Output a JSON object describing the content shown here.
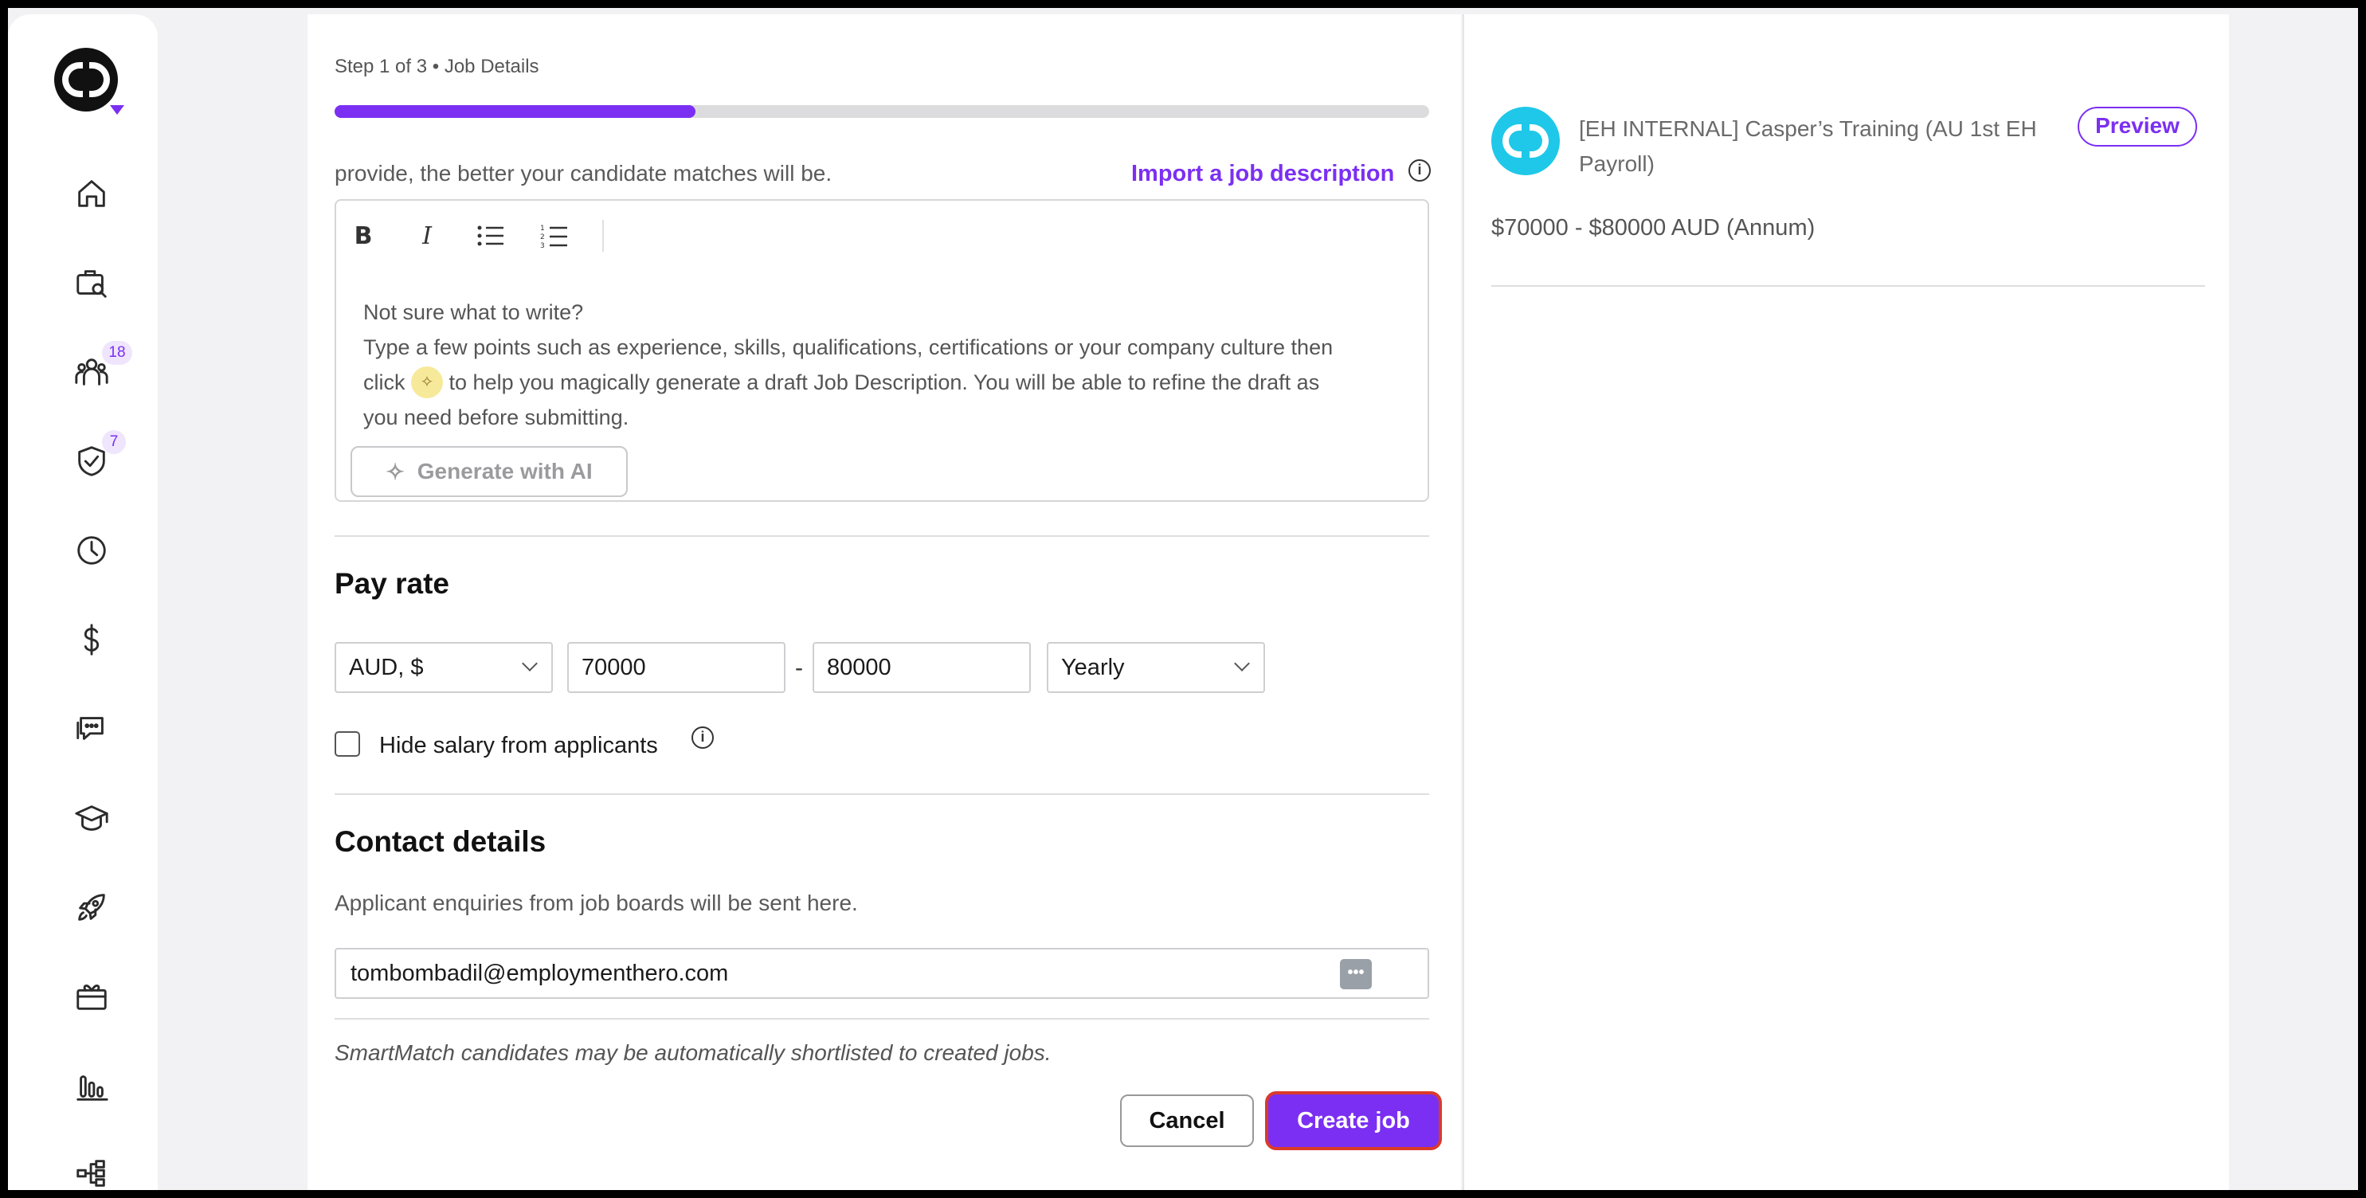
{
  "sidebar": {
    "badges": {
      "people": "18",
      "approvals": "7"
    },
    "items": [
      "home-icon",
      "job-search-icon",
      "people-icon",
      "shield-check-icon",
      "clock-icon",
      "dollar-icon",
      "chat-icon",
      "graduation-cap-icon",
      "rocket-icon",
      "gift-icon",
      "bar-chart-icon",
      "org-chart-icon"
    ]
  },
  "header": {
    "step": "Step 1 of 3 • Job Details",
    "progress": 0.33
  },
  "description": {
    "intro": "provide, the better your candidate matches will be.",
    "import_link": "Import a job description",
    "toolbar": {
      "bold": "B",
      "italic": "I"
    },
    "placeholder_line1": "Not sure what to write?",
    "placeholder_line2": "Type a few points such as experience, skills, qualifications, certifications or your company culture then",
    "placeholder_line3_a": "click",
    "placeholder_line3_b": "to help you magically generate a draft Job Description. You will be able to refine the draft as",
    "placeholder_line4": "you need before submitting.",
    "generate_button": "Generate with AI"
  },
  "pay_rate": {
    "title": "Pay rate",
    "currency": "AUD, $",
    "min": "70000",
    "dash": "-",
    "max": "80000",
    "period": "Yearly",
    "hide_salary_label": "Hide salary from applicants",
    "hide_salary_checked": false
  },
  "contact": {
    "title": "Contact details",
    "helper": "Applicant enquiries from job boards will be sent here.",
    "email": "tombombadil@employmenthero.com",
    "note": "SmartMatch candidates may be automatically shortlisted to created jobs."
  },
  "actions": {
    "cancel": "Cancel",
    "create": "Create job"
  },
  "preview": {
    "company_name": "[EH INTERNAL] Casper’s Training (AU 1st EH Payroll)",
    "badge": "Preview",
    "salary": "$70000 - $80000 AUD (Annum)"
  },
  "colors": {
    "accent": "#7b2ff2",
    "company_logo": "#1fc8e8",
    "focus_ring": "#d93a2b"
  }
}
